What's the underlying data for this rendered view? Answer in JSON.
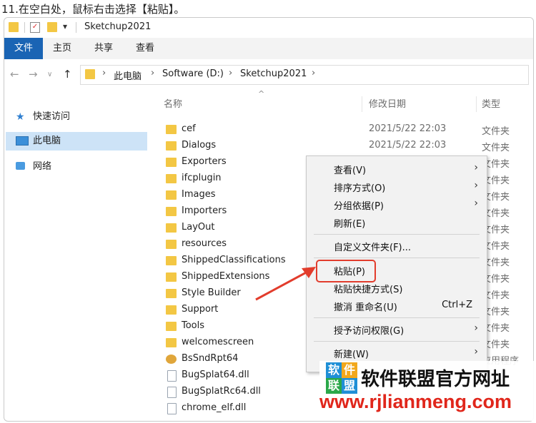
{
  "caption": "11.在空白处，鼠标右击选择【粘贴】。",
  "window": {
    "title": "Sketchup2021",
    "tabs": [
      "文件",
      "主页",
      "共享",
      "查看"
    ]
  },
  "address": {
    "crumbs": [
      "此电脑",
      "Software (D:)",
      "Sketchup2021"
    ]
  },
  "sidebar": {
    "items": [
      {
        "label": "快速访问",
        "icon": "star-icon"
      },
      {
        "label": "此电脑",
        "icon": "computer-icon"
      },
      {
        "label": "网络",
        "icon": "network-icon"
      }
    ]
  },
  "columns": {
    "name": "名称",
    "date": "修改日期",
    "type": "类型"
  },
  "files": [
    {
      "name": "cef",
      "date": "2021/5/22 22:03",
      "type": "文件夹",
      "icon": "folder-icon"
    },
    {
      "name": "Dialogs",
      "date": "2021/5/22 22:03",
      "type": "文件夹",
      "icon": "folder-icon"
    },
    {
      "name": "Exporters",
      "date": "",
      "type": "文件夹",
      "icon": "folder-icon"
    },
    {
      "name": "ifcplugin",
      "date": "",
      "type": "文件夹",
      "icon": "folder-icon"
    },
    {
      "name": "Images",
      "date": "",
      "type": "文件夹",
      "icon": "folder-icon"
    },
    {
      "name": "Importers",
      "date": "",
      "type": "文件夹",
      "icon": "folder-icon"
    },
    {
      "name": "LayOut",
      "date": "",
      "type": "文件夹",
      "icon": "folder-icon"
    },
    {
      "name": "resources",
      "date": "",
      "type": "文件夹",
      "icon": "folder-icon"
    },
    {
      "name": "ShippedClassifications",
      "date": "",
      "type": "文件夹",
      "icon": "folder-icon"
    },
    {
      "name": "ShippedExtensions",
      "date": "",
      "type": "文件夹",
      "icon": "folder-icon"
    },
    {
      "name": "Style Builder",
      "date": "",
      "type": "文件夹",
      "icon": "folder-icon"
    },
    {
      "name": "Support",
      "date": "",
      "type": "文件夹",
      "icon": "folder-icon"
    },
    {
      "name": "Tools",
      "date": "",
      "type": "文件夹",
      "icon": "folder-icon"
    },
    {
      "name": "welcomescreen",
      "date": "",
      "type": "文件夹",
      "icon": "folder-icon"
    },
    {
      "name": "BsSndRpt64",
      "date": "",
      "type": "应用程序",
      "icon": "app-icon"
    },
    {
      "name": "BugSplat64.dll",
      "date": "",
      "type": "",
      "icon": "dll-icon"
    },
    {
      "name": "BugSplatRc64.dll",
      "date": "",
      "type": "",
      "icon": "dll-icon"
    },
    {
      "name": "chrome_elf.dll",
      "date": "",
      "type": "",
      "icon": "dll-icon"
    }
  ],
  "context_menu": {
    "items": [
      {
        "label": "查看(V)",
        "shortcut": "",
        "submenu": true
      },
      {
        "label": "排序方式(O)",
        "shortcut": "",
        "submenu": true
      },
      {
        "label": "分组依据(P)",
        "shortcut": "",
        "submenu": true
      },
      {
        "label": "刷新(E)",
        "shortcut": "",
        "submenu": false
      },
      {
        "label": "自定义文件夹(F)...",
        "shortcut": "",
        "submenu": false
      },
      {
        "label": "粘贴(P)",
        "shortcut": "",
        "submenu": false
      },
      {
        "label": "粘贴快捷方式(S)",
        "shortcut": "",
        "submenu": false
      },
      {
        "label": "撤消 重命名(U)",
        "shortcut": "Ctrl+Z",
        "submenu": false
      },
      {
        "label": "授予访问权限(G)",
        "shortcut": "",
        "submenu": true
      },
      {
        "label": "新建(W)",
        "shortcut": "",
        "submenu": true
      }
    ]
  },
  "watermark": {
    "logo_chars": [
      "软",
      "件",
      "联",
      "盟"
    ],
    "title": "软件联盟官方网址",
    "url": "www.rjlianmeng.com"
  },
  "colors": {
    "accent": "#1a64b4",
    "highlight": "#e23c2c",
    "folder": "#f3c744",
    "watermark_url": "#e0261b"
  }
}
